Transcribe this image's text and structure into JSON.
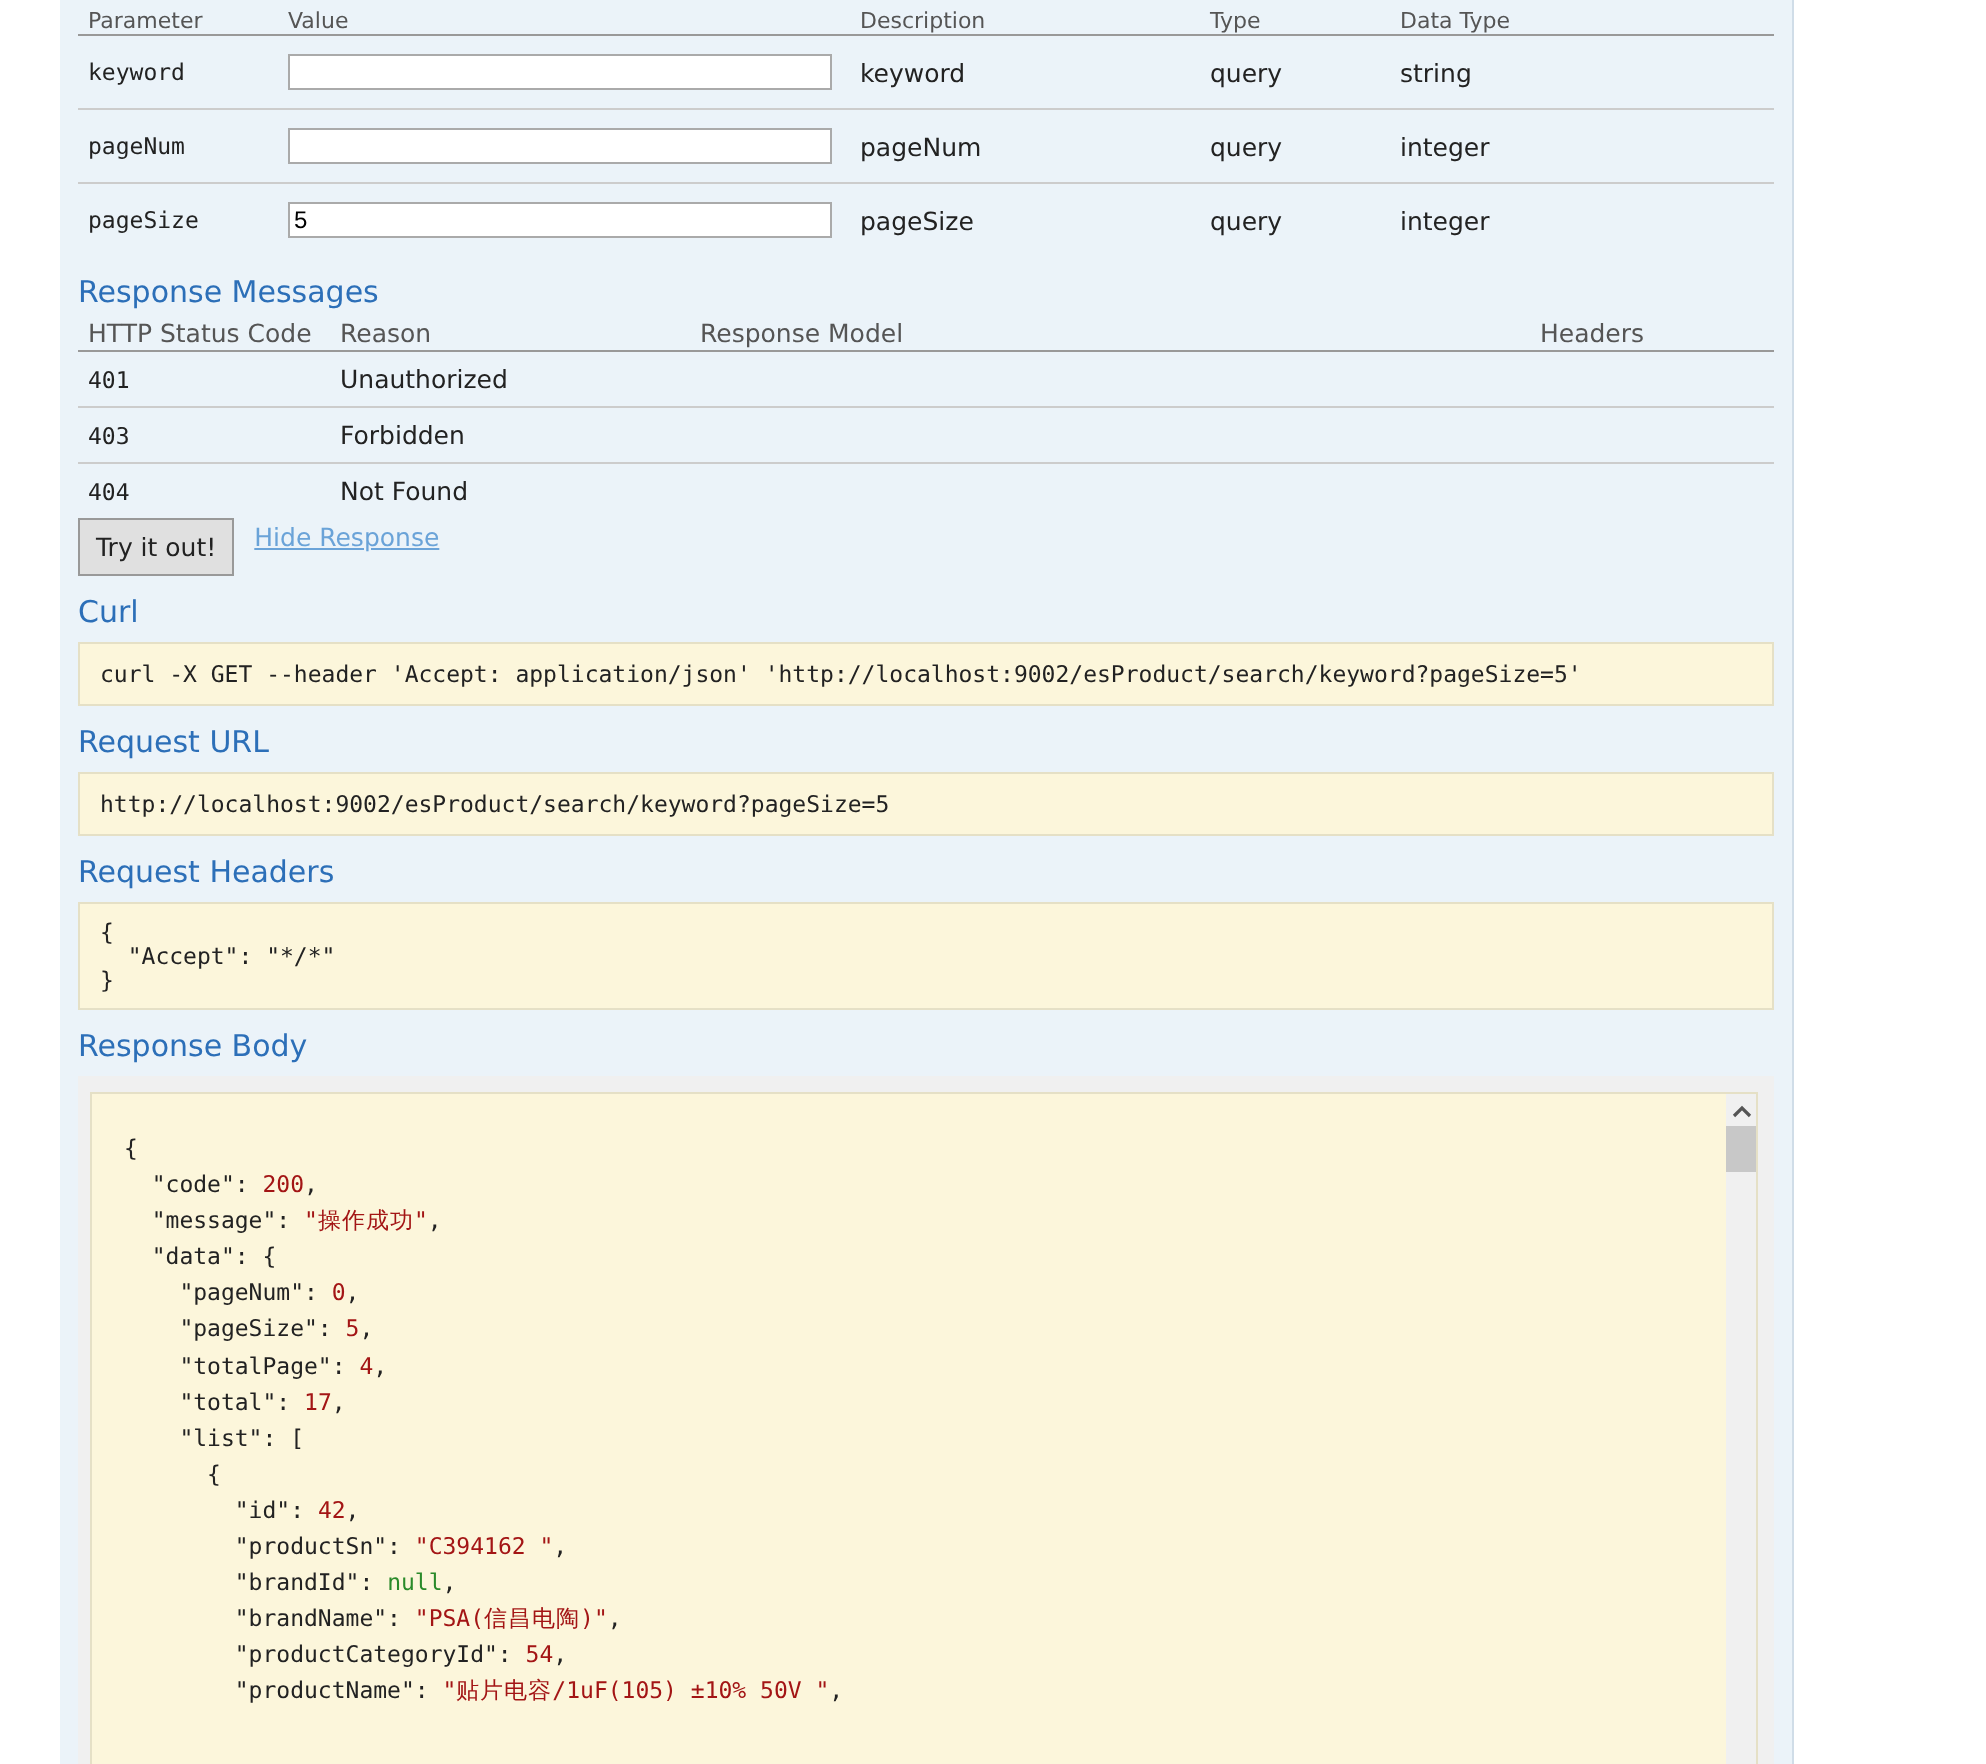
{
  "parameters": {
    "columns": [
      "Parameter",
      "Value",
      "Description",
      "Type",
      "Data Type"
    ],
    "rows": [
      {
        "name": "keyword",
        "value": "",
        "description": "keyword",
        "type": "query",
        "data_type": "string"
      },
      {
        "name": "pageNum",
        "value": "",
        "description": "pageNum",
        "type": "query",
        "data_type": "integer"
      },
      {
        "name": "pageSize",
        "value": "5",
        "description": "pageSize",
        "type": "query",
        "data_type": "integer"
      }
    ]
  },
  "response_messages": {
    "title": "Response Messages",
    "columns": [
      "HTTP Status Code",
      "Reason",
      "Response Model",
      "Headers"
    ],
    "rows": [
      {
        "code": "401",
        "reason": "Unauthorized"
      },
      {
        "code": "403",
        "reason": "Forbidden"
      },
      {
        "code": "404",
        "reason": "Not Found"
      }
    ]
  },
  "try_button": "Try it out!",
  "hide_link": "Hide Response",
  "sections": [
    {
      "title": "Curl",
      "lines": [
        "curl -X GET --header 'Accept: application/json' 'http://localhost:9002/esProduct/search/keyword?pageSize=5'"
      ]
    },
    {
      "title": "Request URL",
      "lines": [
        "http://localhost:9002/esProduct/search/keyword?pageSize=5"
      ]
    },
    {
      "title": "Request Headers",
      "lines": [
        "{",
        "  \"Accept\": \"*/*\"",
        "}"
      ]
    }
  ],
  "response_body": {
    "title": "Response Body",
    "lines": [
      [
        {
          "text": "{",
          "kind": "plain"
        }
      ],
      [
        {
          "text": "  \"code\": ",
          "kind": "plain"
        },
        {
          "text": "200",
          "kind": "number"
        },
        {
          "text": ",",
          "kind": "plain"
        }
      ],
      [
        {
          "text": "  \"message\": ",
          "kind": "plain"
        },
        {
          "text": "\"操作成功\"",
          "kind": "string"
        },
        {
          "text": ",",
          "kind": "plain"
        }
      ],
      [
        {
          "text": "  \"data\": {",
          "kind": "plain"
        }
      ],
      [
        {
          "text": "    \"pageNum\": ",
          "kind": "plain"
        },
        {
          "text": "0",
          "kind": "number"
        },
        {
          "text": ",",
          "kind": "plain"
        }
      ],
      [
        {
          "text": "    \"pageSize\": ",
          "kind": "plain"
        },
        {
          "text": "5",
          "kind": "number"
        },
        {
          "text": ",",
          "kind": "plain"
        }
      ],
      [
        {
          "text": "    \"totalPage\": ",
          "kind": "plain"
        },
        {
          "text": "4",
          "kind": "number"
        },
        {
          "text": ",",
          "kind": "plain"
        }
      ],
      [
        {
          "text": "    \"total\": ",
          "kind": "plain"
        },
        {
          "text": "17",
          "kind": "number"
        },
        {
          "text": ",",
          "kind": "plain"
        }
      ],
      [
        {
          "text": "    \"list\": [",
          "kind": "plain"
        }
      ],
      [
        {
          "text": "      {",
          "kind": "plain"
        }
      ],
      [
        {
          "text": "        \"id\": ",
          "kind": "plain"
        },
        {
          "text": "42",
          "kind": "number"
        },
        {
          "text": ",",
          "kind": "plain"
        }
      ],
      [
        {
          "text": "        \"productSn\": ",
          "kind": "plain"
        },
        {
          "text": "\"C394162 \"",
          "kind": "string"
        },
        {
          "text": ",",
          "kind": "plain"
        }
      ],
      [
        {
          "text": "        \"brandId\": ",
          "kind": "plain"
        },
        {
          "text": "null",
          "kind": "null"
        },
        {
          "text": ",",
          "kind": "plain"
        }
      ],
      [
        {
          "text": "        \"brandName\": ",
          "kind": "plain"
        },
        {
          "text": "\"PSA(信昌电陶)\"",
          "kind": "string"
        },
        {
          "text": ",",
          "kind": "plain"
        }
      ],
      [
        {
          "text": "        \"productCategoryId\": ",
          "kind": "plain"
        },
        {
          "text": "54",
          "kind": "number"
        },
        {
          "text": ",",
          "kind": "plain"
        }
      ],
      [
        {
          "text": "        \"productName\": ",
          "kind": "plain"
        },
        {
          "text": "\"贴片电容/1uF(105) ±10% 50V \"",
          "kind": "string"
        },
        {
          "text": ",",
          "kind": "plain"
        }
      ]
    ]
  }
}
